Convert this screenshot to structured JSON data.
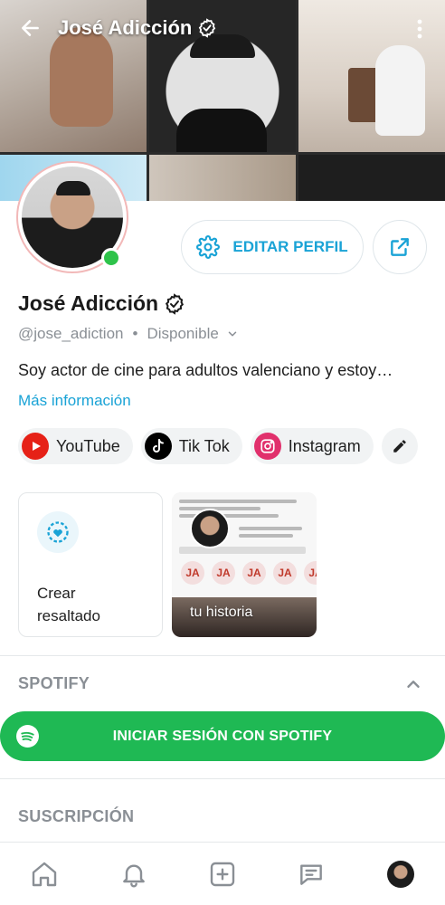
{
  "header": {
    "title": "José Adicción",
    "back_icon": "arrow-left-icon",
    "menu_icon": "more-vertical-icon",
    "verified_icon": "verified-badge-icon"
  },
  "profile": {
    "display_name": "José Adicción",
    "handle": "@jose_adiction",
    "separator": "•",
    "status": "Disponible",
    "bio": "Soy actor de cine para adultos valenciano y estoy…",
    "more_info": "Más información",
    "online": true
  },
  "actions": {
    "edit_profile": "EDITAR PERFIL",
    "edit_icon": "gear-icon",
    "share_icon": "share-icon"
  },
  "social_links": [
    {
      "label": "YouTube",
      "icon": "youtube-icon",
      "color": "#e62117"
    },
    {
      "label": "Tik Tok",
      "icon": "tiktok-icon",
      "color": "#000000"
    },
    {
      "label": "Instagram",
      "icon": "instagram-icon",
      "color": "#e1306c"
    }
  ],
  "highlights": {
    "create_label": "Crear resaltado",
    "story_label": "tu historia"
  },
  "sections": {
    "spotify_title": "SPOTIFY",
    "spotify_button": "INICIAR SESIÓN CON SPOTIFY",
    "subscription_title": "SUSCRIPCIÓN"
  },
  "bottom_nav": [
    {
      "name": "home",
      "icon": "home-icon"
    },
    {
      "name": "notifications",
      "icon": "bell-icon"
    },
    {
      "name": "new-post",
      "icon": "plus-square-icon"
    },
    {
      "name": "messages",
      "icon": "chat-icon"
    },
    {
      "name": "profile",
      "icon": "avatar-icon"
    }
  ],
  "colors": {
    "accent": "#1aa3d6",
    "spotify": "#1fb954",
    "online": "#2ec34a",
    "muted_text": "#8a8f95"
  }
}
